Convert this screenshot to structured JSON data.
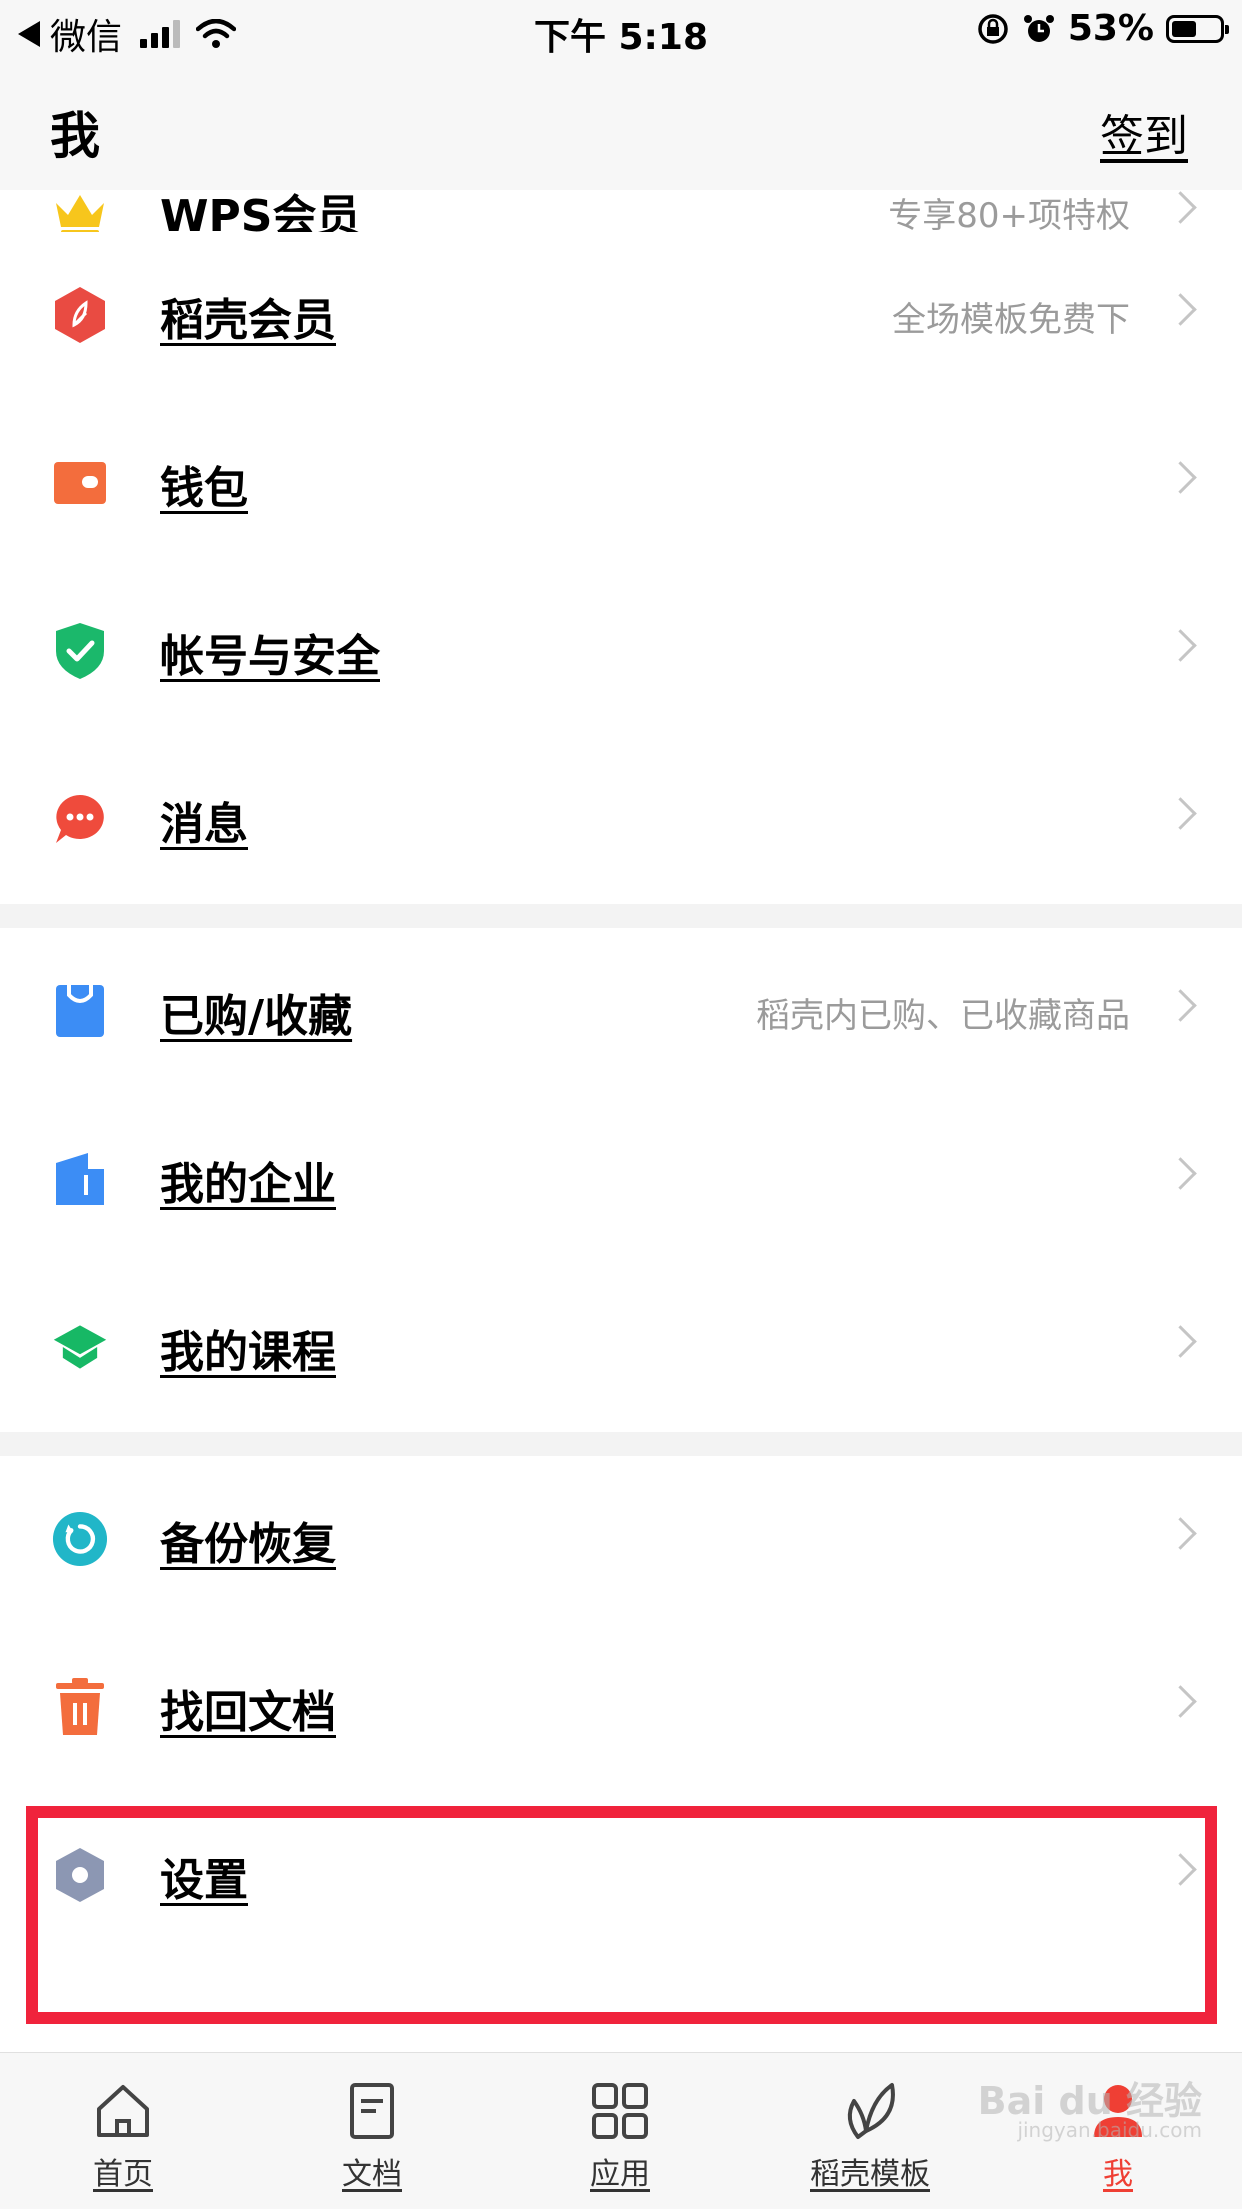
{
  "status_bar": {
    "back_app": "微信",
    "time": "下午 5:18",
    "battery_text": "53%",
    "battery_level": 0.53
  },
  "nav": {
    "title": "我",
    "checkin": "签到"
  },
  "menu": {
    "wps_member": {
      "label": "WPS会员",
      "sub": "专享80+项特权",
      "icon": "crown-icon",
      "color": "#f7c61c"
    },
    "docer_member": {
      "label": "稻壳会员",
      "sub": "全场模板免费下",
      "icon": "docer-hexagon-icon",
      "color": "#e94b42"
    },
    "wallet": {
      "label": "钱包",
      "icon": "wallet-icon",
      "color": "#f36d3d"
    },
    "account_security": {
      "label": "帐号与安全",
      "icon": "shield-check-icon",
      "color": "#1bb86b"
    },
    "messages": {
      "label": "消息",
      "icon": "chat-bubble-icon",
      "color": "#ef4b3c"
    },
    "purchased": {
      "label": "已购/收藏",
      "sub": "稻壳内已购、已收藏商品",
      "icon": "shopping-bag-icon",
      "color": "#3c8df5"
    },
    "enterprise": {
      "label": "我的企业",
      "icon": "building-icon",
      "color": "#3c8df5"
    },
    "courses": {
      "label": "我的课程",
      "icon": "graduation-cap-icon",
      "color": "#17b865"
    },
    "backup": {
      "label": "备份恢复",
      "icon": "backup-restore-icon",
      "color": "#21b6c8"
    },
    "recover": {
      "label": "找回文档",
      "icon": "trash-icon",
      "color": "#f36d3d"
    },
    "settings": {
      "label": "设置",
      "icon": "gear-hexagon-icon",
      "color": "#8c97b3"
    }
  },
  "tabs": [
    {
      "label": "首页",
      "icon": "home-icon"
    },
    {
      "label": "文档",
      "icon": "document-icon"
    },
    {
      "label": "应用",
      "icon": "apps-grid-icon"
    },
    {
      "label": "稻壳模板",
      "icon": "leaf-icon"
    },
    {
      "label": "我",
      "icon": "person-icon",
      "active": true
    }
  ],
  "watermark": {
    "line1": "Bai du 经验",
    "line2": "jingyan.baidu.com"
  },
  "colors": {
    "highlight": "#f0233c",
    "active_tab": "#ef3f34"
  }
}
